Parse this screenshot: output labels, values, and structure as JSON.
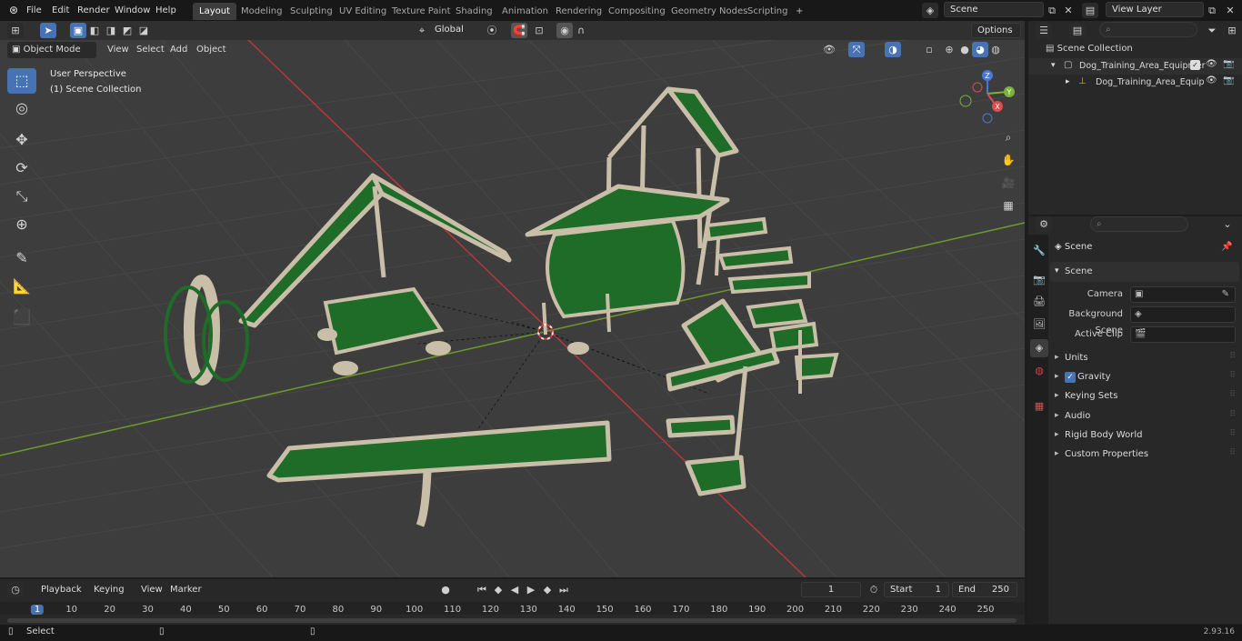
{
  "topbar": {
    "menus": [
      "File",
      "Edit",
      "Render",
      "Window",
      "Help"
    ],
    "workspaces": [
      "Layout",
      "Modeling",
      "Sculpting",
      "UV Editing",
      "Texture Paint",
      "Shading",
      "Animation",
      "Rendering",
      "Compositing",
      "Geometry Nodes",
      "Scripting"
    ],
    "active_workspace": "Layout",
    "add_workspace": "+",
    "scene_name": "Scene",
    "view_layer": "View Layer"
  },
  "tool_header": {
    "transform_orientation": "Global",
    "options_label": "Options"
  },
  "viewport_header": {
    "mode": "Object Mode",
    "menus": [
      "View",
      "Select",
      "Add",
      "Object"
    ]
  },
  "viewport": {
    "view_name": "User Perspective",
    "collection": "(1) Scene Collection",
    "gizmo": {
      "x": "X",
      "y": "Y",
      "z": "Z"
    }
  },
  "toolbar": {
    "tools": [
      "select-box-icon",
      "cursor-icon",
      "move-icon",
      "rotate-icon",
      "scale-icon",
      "transform-icon",
      "annotate-icon",
      "measure-icon",
      "add-cube-icon"
    ]
  },
  "outliner": {
    "root": "Scene Collection",
    "items": [
      {
        "label": "Dog_Training_Area_Equipmer",
        "level": 1,
        "expanded": true
      },
      {
        "label": "Dog_Training_Area_Equip",
        "level": 2,
        "expanded": false
      }
    ]
  },
  "properties": {
    "breadcrumb": "Scene",
    "section": "Scene",
    "fields": [
      {
        "label": "Camera",
        "value": ""
      },
      {
        "label": "Background Scene",
        "value": ""
      },
      {
        "label": "Active Clip",
        "value": ""
      }
    ],
    "panels": [
      {
        "label": "Units",
        "checkbox": false
      },
      {
        "label": "Gravity",
        "checkbox": true
      },
      {
        "label": "Keying Sets",
        "checkbox": false
      },
      {
        "label": "Audio",
        "checkbox": false
      },
      {
        "label": "Rigid Body World",
        "checkbox": false
      },
      {
        "label": "Custom Properties",
        "checkbox": false
      }
    ]
  },
  "timeline": {
    "menus": [
      "Playback",
      "Keying",
      "View",
      "Marker"
    ],
    "current_frame": "1",
    "start_label": "Start",
    "start": "1",
    "end_label": "End",
    "end": "250",
    "ruler": [
      "1",
      "10",
      "20",
      "30",
      "40",
      "50",
      "60",
      "70",
      "80",
      "90",
      "100",
      "110",
      "120",
      "130",
      "140",
      "150",
      "160",
      "170",
      "180",
      "190",
      "200",
      "210",
      "220",
      "230",
      "240",
      "250"
    ]
  },
  "statusbar": {
    "left": "Select",
    "version": "2.93.16"
  },
  "colors": {
    "accent": "#4772b3",
    "equipment_green": "#1f6b28",
    "equipment_frame": "#c9bfa9",
    "grid": "#4a4a4a",
    "x_axis": "#b8383d",
    "y_axis": "#6f9a2a"
  }
}
